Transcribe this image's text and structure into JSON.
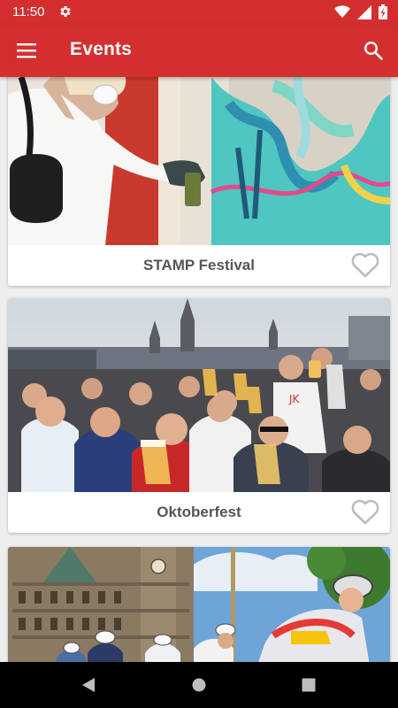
{
  "status_bar": {
    "time": "11:50",
    "icons": [
      "settings-gear-icon",
      "wifi-icon",
      "signal-icon",
      "battery-charging-icon"
    ]
  },
  "app_bar": {
    "title": "Events",
    "left_icon": "menu-icon",
    "right_icon": "search-icon",
    "color": "#d32f2f"
  },
  "events": [
    {
      "title": "STAMP Festival",
      "image": "graffiti-artist-photo",
      "favorite": false
    },
    {
      "title": "Oktoberfest",
      "image": "beer-toast-crowd-photo",
      "favorite": false
    },
    {
      "title": "",
      "image": "cycling-race-city-hall-photo",
      "favorite": false
    }
  ],
  "nav_bar": {
    "buttons": [
      "back-icon",
      "home-icon",
      "recents-icon"
    ]
  }
}
